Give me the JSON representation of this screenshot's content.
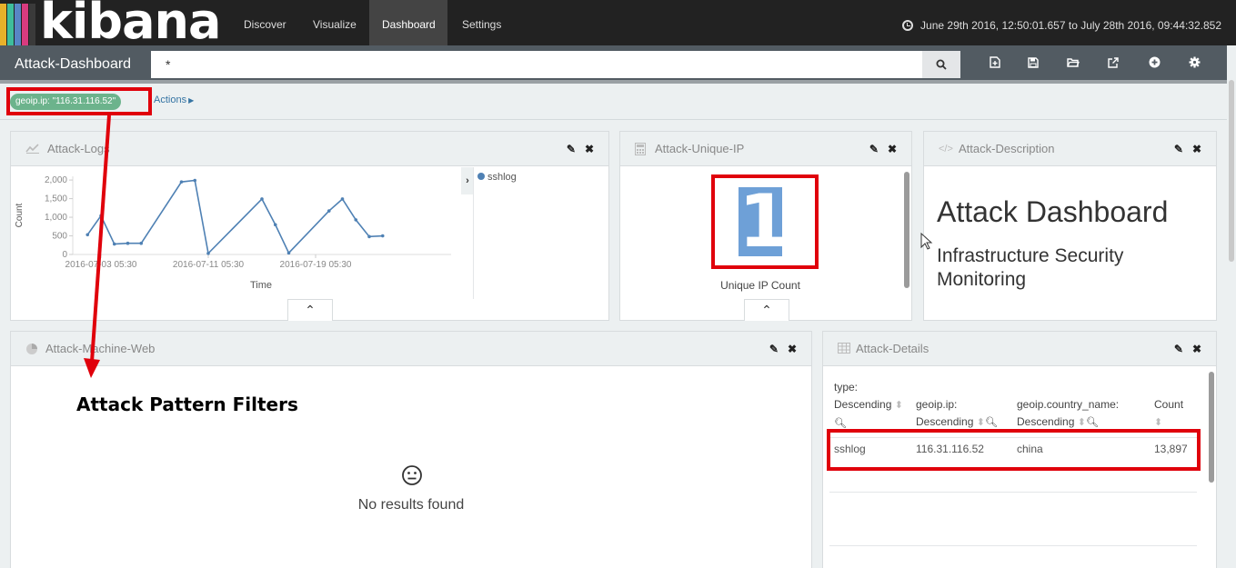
{
  "nav": {
    "logo": "kibana",
    "links": [
      "Discover",
      "Visualize",
      "Dashboard",
      "Settings"
    ],
    "active_link": "Dashboard",
    "time_range": "June 29th 2016, 12:50:01.657 to July 28th 2016, 09:44:32.852"
  },
  "dashboard": {
    "title": "Attack-Dashboard",
    "query": "*"
  },
  "filters": {
    "pill": "geoip.ip: \"116.31.116.52\"",
    "actions": "Actions"
  },
  "panels": {
    "logs": {
      "title": "Attack-Logs",
      "legend": "sshlog"
    },
    "unique_ip": {
      "title": "Attack-Unique-IP",
      "value": "1",
      "label": "Unique IP Count"
    },
    "description": {
      "title": "Attack-Description",
      "heading": "Attack Dashboard",
      "subheading": "Infrastructure Security Monitoring"
    },
    "machine_web": {
      "title": "Attack-Machine-Web",
      "empty_text": "No results found"
    },
    "details": {
      "title": "Attack-Details",
      "columns": [
        {
          "name": "type:",
          "sort": "Descending"
        },
        {
          "name": "geoip.ip:",
          "sort": "Descending"
        },
        {
          "name": "geoip.country_name:",
          "sort": "Descending"
        },
        {
          "name": "Count",
          "sort": ""
        }
      ],
      "rows": [
        {
          "type": "sshlog",
          "ip": "116.31.116.52",
          "country": "china",
          "count": "13,897"
        }
      ]
    }
  },
  "annotation": "Attack Pattern Filters",
  "colors": {
    "highlight": "#e0000b",
    "series": "#4f81b4",
    "filter_pill": "#6cb38c",
    "metric_selection": "#6ea0d7"
  },
  "chart_data": {
    "type": "line",
    "xlabel": "Time",
    "ylabel": "Count",
    "x_ticks": [
      "2016-07-03 05:30",
      "2016-07-11 05:30",
      "2016-07-19 05:30"
    ],
    "y_ticks": [
      "0",
      "500",
      "1,000",
      "1,500",
      "2,000"
    ],
    "ylim": [
      0,
      2100
    ],
    "series": [
      {
        "name": "sshlog",
        "x": [
          "2016-07-02",
          "2016-07-03",
          "2016-07-04",
          "2016-07-05",
          "2016-07-06",
          "2016-07-09",
          "2016-07-10",
          "2016-07-11",
          "2016-07-15",
          "2016-07-16",
          "2016-07-17",
          "2016-07-20",
          "2016-07-21",
          "2016-07-22",
          "2016-07-23",
          "2016-07-24"
        ],
        "values": [
          530,
          1040,
          280,
          300,
          300,
          1950,
          1990,
          30,
          1490,
          800,
          40,
          1170,
          1490,
          930,
          480,
          500
        ]
      }
    ]
  }
}
